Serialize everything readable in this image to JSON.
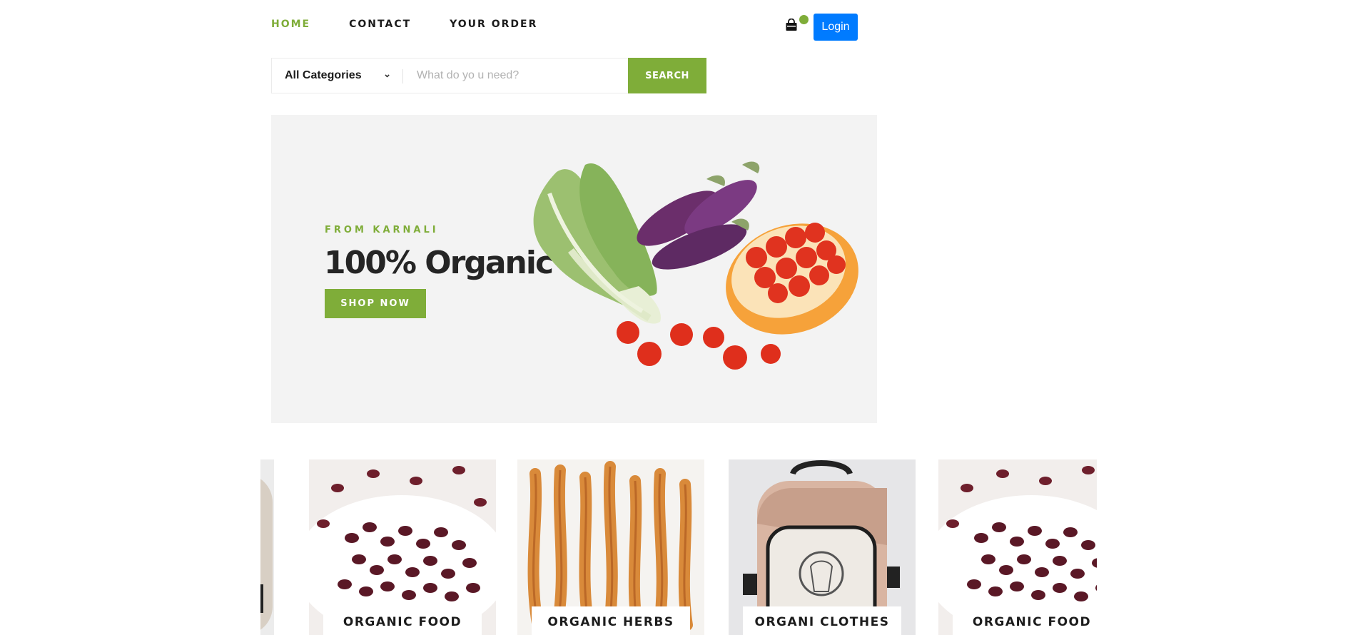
{
  "nav": {
    "items": [
      {
        "label": "HOME",
        "active": true
      },
      {
        "label": "CONTACT",
        "active": false
      },
      {
        "label": "YOUR ORDER",
        "active": false
      }
    ],
    "login_label": "Login",
    "cart_icon": "shopping-bag-icon"
  },
  "search": {
    "category_label": "All Categories",
    "placeholder": "What do yo u need?",
    "button_label": "SEARCH"
  },
  "hero": {
    "kicker": "FROM KARNALI",
    "title": "100% Organic",
    "button_label": "SHOP NOW"
  },
  "products": [
    {
      "label": "",
      "image": "backpack-image"
    },
    {
      "label": "ORGANIC FOOD",
      "image": "red-beans-image"
    },
    {
      "label": "ORGANIC HERBS",
      "image": "cordyceps-herbs-image"
    },
    {
      "label": "ORGANI CLOTHES",
      "image": "hemp-backpack-image"
    },
    {
      "label": "ORGANIC FOOD",
      "image": "red-beans-image"
    }
  ],
  "colors": {
    "accent": "#7fad39",
    "login": "#007bff",
    "text": "#1c1c1c",
    "hero_bg": "#f3f3f3"
  }
}
